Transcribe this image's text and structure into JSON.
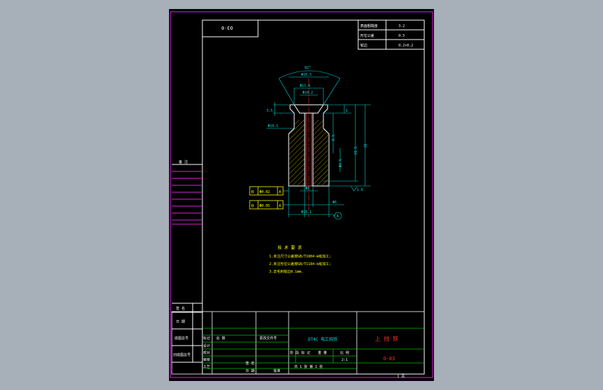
{
  "drawing_code_box": "03-0",
  "roughness_table": {
    "rows": [
      {
        "label": "表面粗糙度",
        "value": "3.2"
      },
      {
        "label": "形位公差",
        "value": "0.5"
      },
      {
        "label": "锐边",
        "value": "0.2×0.2"
      }
    ]
  },
  "dimensions": {
    "cone_angle": "82°",
    "d_top": "Φ16.5",
    "d_mid": "Φ11.8",
    "d_inner": "Φ10.2",
    "h_left": "3.5",
    "h_right_small": "1",
    "d_shank": "Φ10.1",
    "d_hole_side": "Φ2.5",
    "len_mid": "8.5",
    "len_total_a": "21.5",
    "len_total_b": "31",
    "d_bottom_small": "Φ3",
    "d_bottom": "Φ16.1",
    "d_bottom_b": "Φ6",
    "surface_mark": "1.6",
    "datum": "A"
  },
  "tolerance_frames": [
    {
      "symbol": "◎",
      "value": "Φ0.02",
      "datum": "A"
    },
    {
      "symbol": "◎",
      "value": "Φ0.05",
      "datum": "A"
    }
  ],
  "tech_notes": {
    "title": "技 术 要 求",
    "lines": [
      "1.未注尺寸公差按GB/T1804-m级加工;",
      "2.未注形位公差按GB/T1184-k级加工;",
      "3.去毛刺锐边0.1mm."
    ]
  },
  "left_strip": {
    "label_top": "备 注",
    "label_a": "签 名",
    "label_b": "日 期",
    "label_c": "底图总号",
    "label_d": "旧底图总号"
  },
  "title_block": {
    "material": "DT4C 电工纯铁",
    "part_name": "上 挡 铁",
    "part_code": "0-03",
    "rows_left": [
      "标记",
      "设计",
      "校对",
      "审核",
      "工艺"
    ],
    "cells": [
      "处 数",
      "更改文件号",
      "签 名",
      "日 期",
      "批准"
    ],
    "mid_labels": [
      "阶 段 标 记",
      "重 量",
      "比 例"
    ],
    "scale": "2:1",
    "sheet_info": "共 1 张  第 1 张",
    "page_no": "1 页"
  }
}
